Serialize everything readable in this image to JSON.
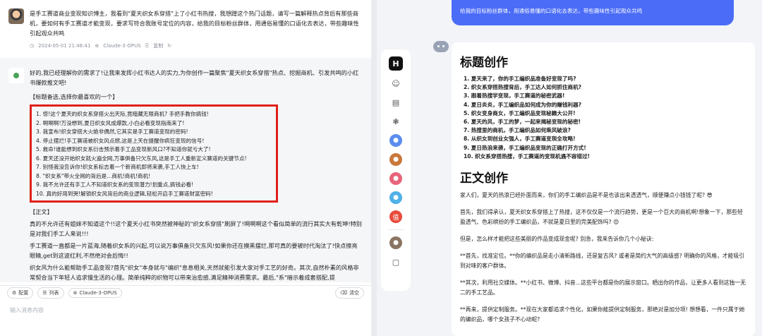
{
  "left": {
    "user_message": "是手工赛道商业变现知识博主，我看到\"夏天织女系穿搭\"上了小红书热搜，我想蹭这个热门话题，请写一篇解释热点背后有那些商机，要如何有手工赛道才能变现，要求写符合我账号定位的内容，给我的目标粉丝群体，用通俗易懂的口语化去表达，带些趣味性引起观众共鸣",
    "user_meta": {
      "timestamp": "2024-05-01 21:46:41",
      "model": "Claude-3-OPUS",
      "copy_label": "复制",
      "refresh_icon": "refresh-icon"
    },
    "bot_intro": "好的,我已经理解你的需求了!让我来发挥小红书达人的实力,为你创作一篇聚焦\"夏天织女系穿搭\"热点、挖掘商机、引发共鸣的小红书爆款推文吧!",
    "titles_header": "【标题备选,选择你最喜欢的一个】",
    "titles": [
      "1. 惊!这个夏天的织女系穿搭火出天际,竟暗藏无限商机? 手把手教你搞钱!",
      "2. 啊啊啊!万没想到,夏日织女风成爆款,小白必看变现指南来了!",
      "3. 我宣布!织女穿搭大火绝非偶然,它其实是手工赛道变现的密码!",
      "4. 停止摆烂!手工赛道被织女风点燃,这是上天在提醒你疯狂变现的信号!",
      "5. 救命!谁能想到织女系衍击预示着手工品变现新风口?不知道你就亏大了!",
      "6. 夏天还没开始织女就火遍全网,万事俱备只欠东风,这是手工人重新定义赛道的关键节点!",
      "7. 别怪我没告诉你!织女系标志着一个新商机即将来袭,手工人快上车!",
      "8. \"织女系\"带火全网的背后是...商机!商机!商机!",
      "9. 我不允许还有手工人不知道织女系的变现潜力!划重点,搞钱必看!",
      "10. 真的好用到哭!解锁织女风背后的商业逻辑,轻松开启手工赛道财富密码!"
    ],
    "body_header": "【正文】",
    "body_paragraphs": [
      "真的不允许还有姐妹不知道这个!!这个夏天小红书突然被神秘的\"织女系穿搭\"刷屏了!啊啊啊这个看似简单的流行其实大有乾坤!特别是对我们手工人来说!!!",
      "手工赛道一直都是一片蓝海,随着织女系的兴起,可以说万事俱备只欠东风!如果你还在摸黑摆烂,那可真的要被时代淘汰了!快点擦亮眼睛,get到这波红利,不然绝对会后悔!!",
      "织女风为什么能帮助手工品变现?首先\"织女\"本身就与\"编织\"息息相关,天然就能引发大家对手工艺的好奇。其次,自然朴素的风格非常契合当下年轻人追求慢生活的心理。简单纯粹的织物可以带来治愈感,满足精神消费需求。最后,\"系\"暗示着成套搭配,提"
    ],
    "toolbar": {
      "config": "配置",
      "list": "列表",
      "model": "Claude-3-OPUS",
      "clear": "清空"
    },
    "input_placeholder": "输入消息内容"
  },
  "right": {
    "user_bubble": "给我的目标粉丝群体，用通俗易懂的口语化去表达，带些趣味性引起观众共鸣",
    "rail_logo": "H",
    "title_section": "标题创作",
    "titles": [
      "1. 夏天来了，你的手工编织品准备好变现了吗?",
      "2. 织女系穿搭热搜背后，手工达人如何抓住商机?",
      "3. 跟着热搜学变现，手工赛道的秘密武器!",
      "4. 夏日炎炎，手工编织品如何成为你的赚钱利器?",
      "5. 织女变身商女，手工编织品变现秘籍大公开!",
      "6. 夏天的风，手工的梦，一起来揭秘变现的秘密!",
      "7. 热搜里的商机，手工编织品如何乘风破浪?",
      "8. 从织女到创业女强人，手工赛道变现全攻略!",
      "9. 夏日热浪来袭，手工编织品变现的正确打开方式!",
      "10. 织女系穿搭热搜，手工赛道的变现机遇不容错过!"
    ],
    "body_section": "正文创作",
    "body_paragraphs": [
      "家人们，夏天的热浪已经扑面而来，你们的手工编织品是不是也该出来透透气，顺便赚点小钱钱了呢? 😎",
      "首先，我们得承认，夏天织女系穿搭上了热搜，这不仅仅是一个流行趋势，更是一个巨大的商机啊!想象一下，那些轻盈透气、色彩缤纷的手工编织品，不就是夏日里的完美配饰吗? 😍",
      "但是，怎么样才能把这些美丽的作品变成现金呢? 别急，我来告诉你几个小秘诀:",
      "**首先，找准定位。**你的编织品是走小清新路线，还是复古风? 或者是简约大气的高级感? 明确你的风格，才能吸引到对味的客户群体。",
      "**其次，利用社交媒体。**小红书、微博、抖音...这些平台都是你的展示窗口。晒出你的作品，让更多人看到这独一无二的手工艺品。",
      "**再来，提供定制服务。**现在大家都追求个性化，如果你能提供定制服务，那绝对是加分项! 想想看，一件只属于她的编织品，哪个女孩子不心动呢?"
    ]
  },
  "colors": {
    "accent_blue": "#4a6cf7",
    "highlight_red": "#e0201b"
  }
}
